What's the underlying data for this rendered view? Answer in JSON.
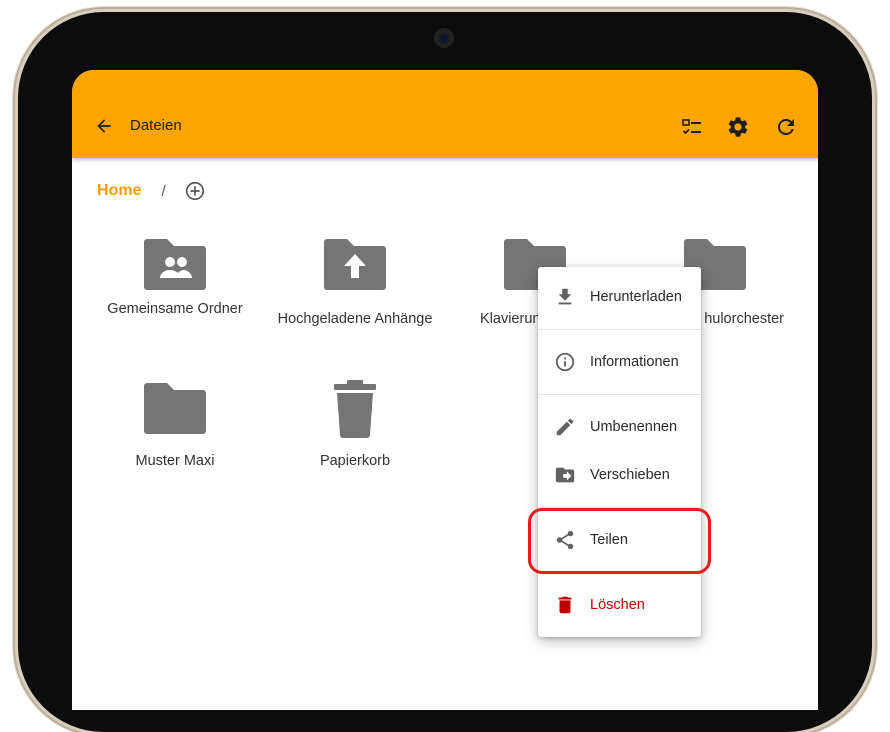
{
  "appbar": {
    "title": "Dateien",
    "color": "#ffa400"
  },
  "breadcrumb": {
    "home": "Home",
    "separator": "/"
  },
  "folders": [
    {
      "label": "Gemeinsame Ordner",
      "icon": "shared-folder-icon"
    },
    {
      "label": "Hochgeladene Anhänge",
      "icon": "upload-folder-icon"
    },
    {
      "label": "Klavierun",
      "icon": "folder-icon"
    },
    {
      "label": "hulorchester",
      "icon": "folder-icon"
    },
    {
      "label": "Muster Maxi",
      "icon": "folder-icon"
    },
    {
      "label": "Papierkorb",
      "icon": "trash-icon"
    }
  ],
  "context_menu": {
    "download": "Herunterladen",
    "info": "Informationen",
    "rename": "Umbenennen",
    "move": "Verschieben",
    "share": "Teilen",
    "delete": "Löschen",
    "delete_color": "#c20000"
  },
  "highlight_color": "#e51d1d"
}
